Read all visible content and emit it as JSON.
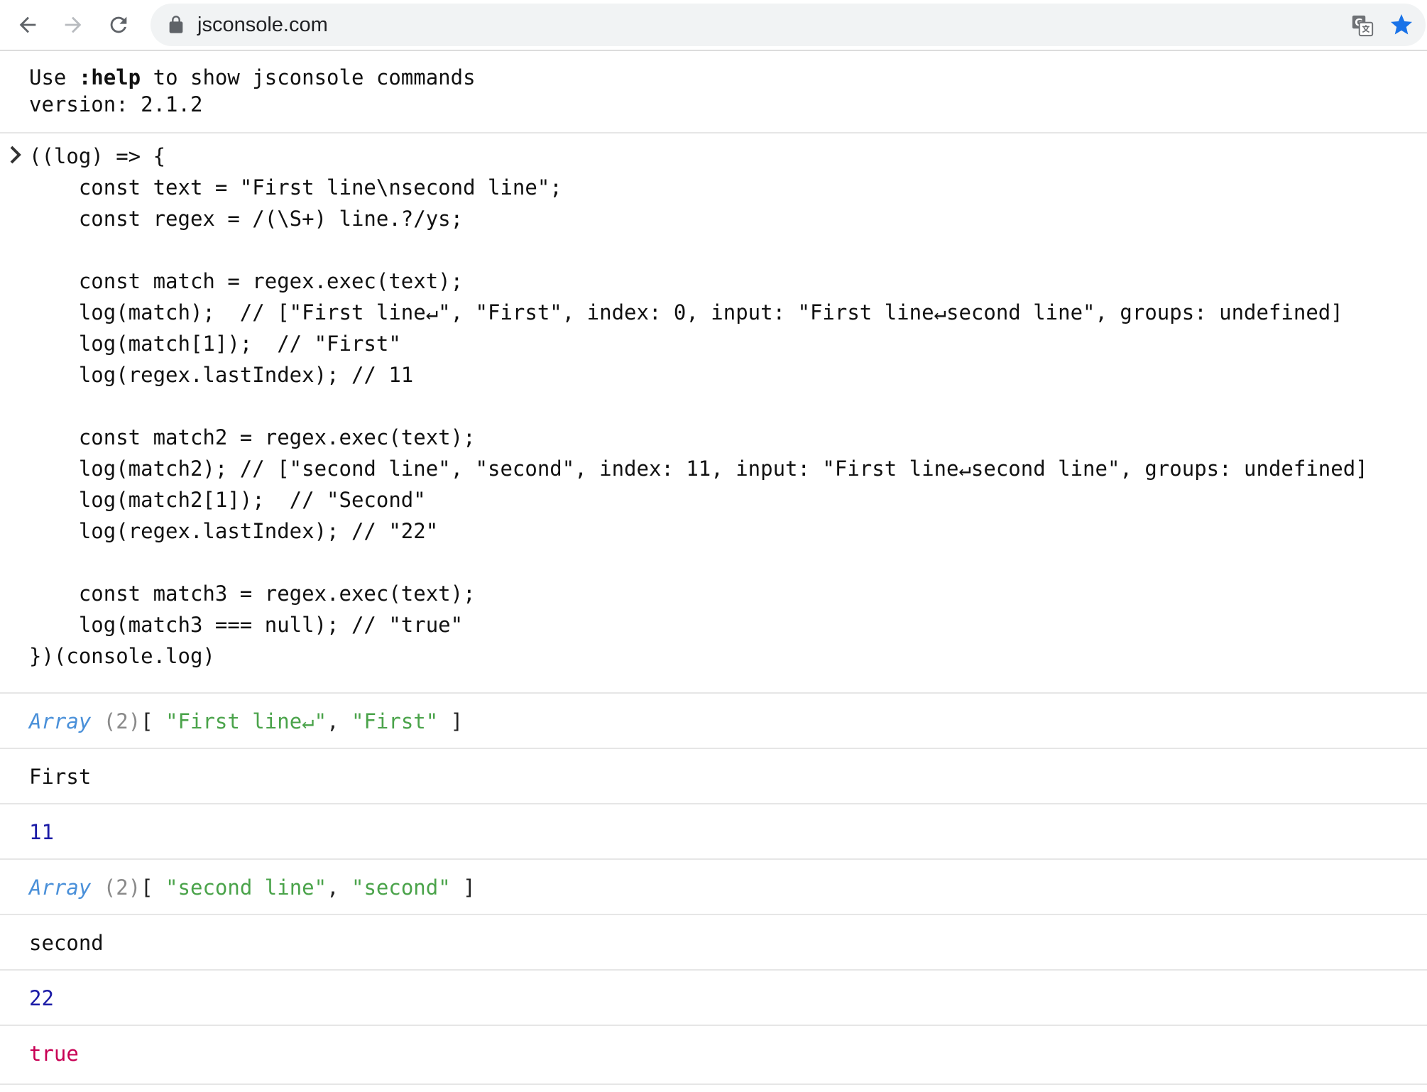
{
  "browser": {
    "url": "jsconsole.com",
    "icons": [
      "back-icon",
      "forward-icon",
      "reload-icon",
      "lock-icon",
      "translate-icon",
      "star-icon"
    ]
  },
  "console": {
    "banner": {
      "help_prefix": "Use ",
      "help_command": ":help",
      "help_suffix": " to show jsconsole commands",
      "version": "version: 2.1.2"
    },
    "input_code": [
      "((log) => {",
      "    const text = \"First line\\nsecond line\";",
      "    const regex = /(\\S+) line.?/ys;",
      "",
      "    const match = regex.exec(text);",
      "    log(match);  // [\"First line↵\", \"First\", index: 0, input: \"First line↵second line\", groups: undefined]",
      "    log(match[1]);  // \"First\"",
      "    log(regex.lastIndex); // 11",
      "",
      "    const match2 = regex.exec(text);",
      "    log(match2); // [\"second line\", \"second\", index: 11, input: \"First line↵second line\", groups: undefined]",
      "    log(match2[1]);  // \"Second\"",
      "    log(regex.lastIndex); // \"22\"",
      "",
      "    const match3 = regex.exec(text);",
      "    log(match3 === null); // \"true\"",
      "})(console.log)"
    ],
    "outputs": {
      "array1": {
        "type": "Array",
        "count": "(2)",
        "open": "[ ",
        "str1": "\"First line↵\"",
        "sep": ", ",
        "str2": "\"First\"",
        "close": " ]"
      },
      "first": "First",
      "n11": "11",
      "array2": {
        "type": "Array",
        "count": "(2)",
        "open": "[ ",
        "str1": "\"second line\"",
        "sep": ", ",
        "str2": "\"second\"",
        "close": " ]"
      },
      "second": "second",
      "n22": "22",
      "bool_true": "true"
    },
    "colors": {
      "number": "#1a1aa6",
      "boolean": "#c80054",
      "type": "#4a90d9",
      "string": "#4aa34a"
    }
  }
}
